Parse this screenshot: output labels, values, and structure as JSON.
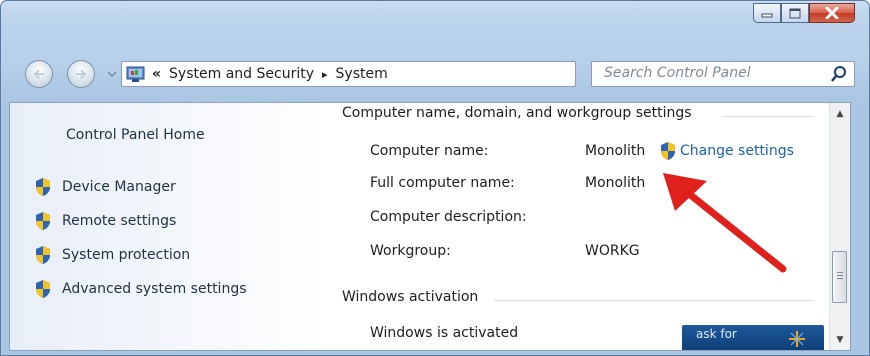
{
  "window": {
    "caption_buttons": [
      "minimize",
      "maximize",
      "close"
    ]
  },
  "address_bar": {
    "chevron": "«",
    "crumbs": [
      "System and Security",
      "System"
    ],
    "separator": "▸"
  },
  "search": {
    "placeholder": "Search Control Panel"
  },
  "sidebar": {
    "home": "Control Panel Home",
    "items": [
      {
        "label": "Device Manager",
        "icon": "shield-icon"
      },
      {
        "label": "Remote settings",
        "icon": "shield-icon"
      },
      {
        "label": "System protection",
        "icon": "shield-icon"
      },
      {
        "label": "Advanced system settings",
        "icon": "shield-icon"
      }
    ]
  },
  "main": {
    "computer_group_title": "Computer name, domain, and workgroup settings",
    "rows": [
      {
        "label": "Computer name:",
        "value": "Monolith"
      },
      {
        "label": "Full computer name:",
        "value": "Monolith"
      },
      {
        "label": "Computer description:",
        "value": ""
      },
      {
        "label": "Workgroup:",
        "value": "WORKG"
      }
    ],
    "change_settings": "Change settings",
    "activation_group_title": "Windows activation",
    "activation_status": "Windows is activated",
    "ask_for": "ask for"
  },
  "colors": {
    "link": "#1a5fb4",
    "annotation_arrow": "#e0201c"
  }
}
